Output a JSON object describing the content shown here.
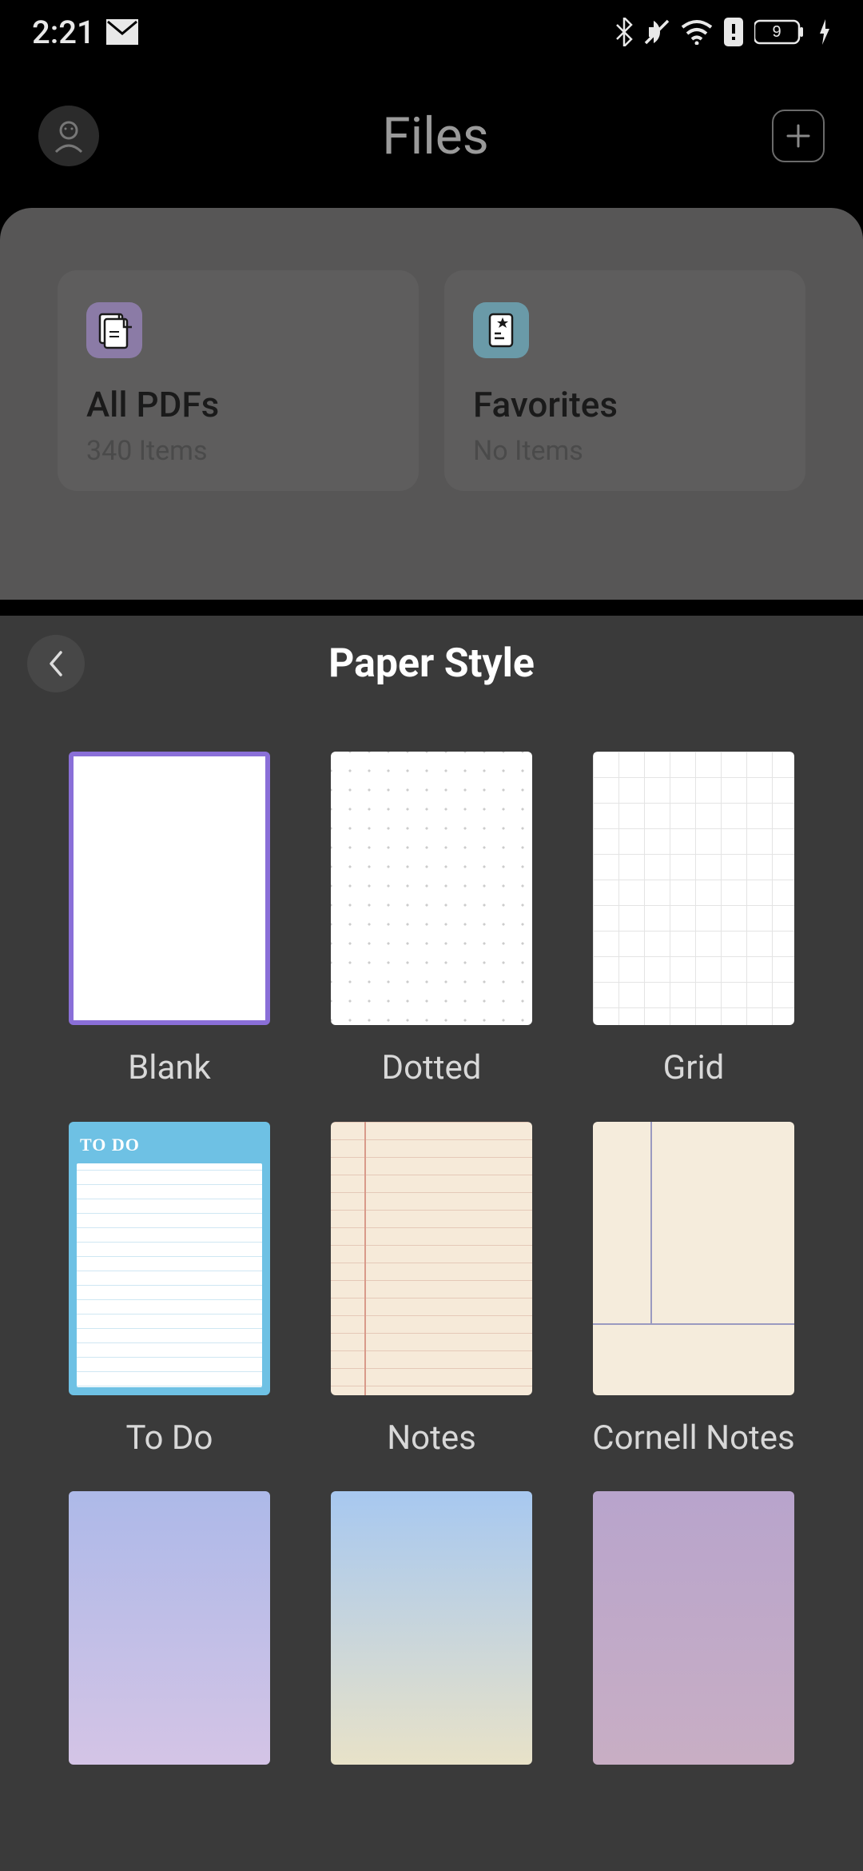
{
  "status": {
    "time": "2:21",
    "battery": "9"
  },
  "header": {
    "title": "Files"
  },
  "cards": [
    {
      "title": "All PDFs",
      "sub": "340 Items",
      "icon": "pdf"
    },
    {
      "title": "Favorites",
      "sub": "No Items",
      "icon": "fav"
    }
  ],
  "sheet": {
    "title": "Paper Style",
    "selected": 0,
    "styles": [
      {
        "label": "Blank",
        "type": "blank"
      },
      {
        "label": "Dotted",
        "type": "dotted"
      },
      {
        "label": "Grid",
        "type": "grid"
      },
      {
        "label": "To Do",
        "type": "todo",
        "todo_header": "TO DO"
      },
      {
        "label": "Notes",
        "type": "notes"
      },
      {
        "label": "Cornell Notes",
        "type": "cornell"
      },
      {
        "label": "",
        "type": "grad1"
      },
      {
        "label": "",
        "type": "grad2"
      },
      {
        "label": "",
        "type": "grad3"
      }
    ]
  }
}
